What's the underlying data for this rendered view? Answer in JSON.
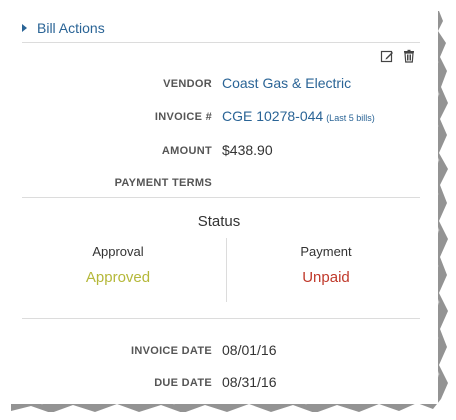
{
  "panel": {
    "header_label": "Bill Actions"
  },
  "toolbar": {
    "edit_icon": "edit-icon",
    "delete_icon": "trash-icon"
  },
  "details": {
    "vendor_label": "VENDOR",
    "vendor_value": "Coast Gas & Electric",
    "invoice_label": "INVOICE #",
    "invoice_value": "CGE 10278-044",
    "invoice_extra": "(Last 5 bills)",
    "amount_label": "AMOUNT",
    "amount_value": "$438.90",
    "terms_label": "PAYMENT TERMS",
    "terms_value": ""
  },
  "status": {
    "title": "Status",
    "approval_label": "Approval",
    "approval_value": "Approved",
    "payment_label": "Payment",
    "payment_value": "Unpaid"
  },
  "dates": {
    "invoice_date_label": "INVOICE DATE",
    "invoice_date_value": "08/01/16",
    "due_date_label": "DUE DATE",
    "due_date_value": "08/31/16"
  },
  "colors": {
    "link": "#2a6496",
    "approved": "#b5b83a",
    "unpaid": "#c0392b"
  }
}
